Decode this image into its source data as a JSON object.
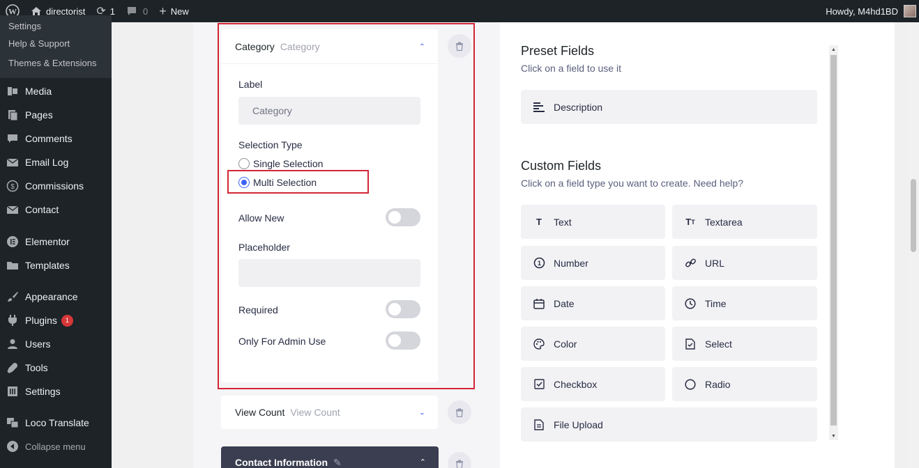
{
  "adminbar": {
    "site_name": "directorist",
    "updates_count": "1",
    "comments_count": "0",
    "new_label": "New",
    "howdy": "Howdy, M4hd1BD"
  },
  "sidebar": {
    "submenu": [
      "Settings",
      "Help & Support",
      "Themes & Extensions"
    ],
    "items": [
      {
        "label": "Media",
        "icon": "media-icon"
      },
      {
        "label": "Pages",
        "icon": "pages-icon"
      },
      {
        "label": "Comments",
        "icon": "comments-icon"
      },
      {
        "label": "Email Log",
        "icon": "email-icon"
      },
      {
        "label": "Commissions",
        "icon": "dollar-icon"
      },
      {
        "label": "Contact",
        "icon": "envelope-icon"
      },
      {
        "label": "Elementor",
        "icon": "elementor-icon"
      },
      {
        "label": "Templates",
        "icon": "folder-icon"
      },
      {
        "label": "Appearance",
        "icon": "brush-icon"
      },
      {
        "label": "Plugins",
        "icon": "plugin-icon",
        "badge": "1"
      },
      {
        "label": "Users",
        "icon": "user-icon"
      },
      {
        "label": "Tools",
        "icon": "wrench-icon"
      },
      {
        "label": "Settings",
        "icon": "settings-icon"
      },
      {
        "label": "Loco Translate",
        "icon": "translate-icon"
      },
      {
        "label": "Collapse menu",
        "icon": "collapse-icon"
      }
    ]
  },
  "category_field": {
    "title": "Category",
    "subtitle": "Category",
    "label_heading": "Label",
    "label_value": "Category",
    "selection_type_heading": "Selection Type",
    "option_single": "Single Selection",
    "option_multi": "Multi Selection",
    "selected_option": "Multi Selection",
    "allow_new": "Allow New",
    "allow_new_on": false,
    "placeholder_heading": "Placeholder",
    "placeholder_value": "",
    "required": "Required",
    "required_on": false,
    "admin_only": "Only For Admin Use",
    "admin_only_on": false
  },
  "view_count_field": {
    "title": "View Count",
    "subtitle": "View Count"
  },
  "contact_section": {
    "title": "Contact Information"
  },
  "preset": {
    "title": "Preset Fields",
    "subtitle": "Click on a field to use it",
    "fields": [
      {
        "label": "Description",
        "icon": "align-left-icon"
      }
    ]
  },
  "custom": {
    "title": "Custom Fields",
    "subtitle": "Click on a field type you want to create. Need help?",
    "fields": [
      {
        "label": "Text",
        "icon": "text-icon"
      },
      {
        "label": "Textarea",
        "icon": "textarea-icon"
      },
      {
        "label": "Number",
        "icon": "number-icon"
      },
      {
        "label": "URL",
        "icon": "link-icon"
      },
      {
        "label": "Date",
        "icon": "calendar-icon"
      },
      {
        "label": "Time",
        "icon": "clock-icon"
      },
      {
        "label": "Color",
        "icon": "palette-icon"
      },
      {
        "label": "Select",
        "icon": "select-icon"
      },
      {
        "label": "Checkbox",
        "icon": "checkbox-icon"
      },
      {
        "label": "Radio",
        "icon": "radio-icon"
      },
      {
        "label": "File Upload",
        "icon": "file-upload-icon"
      }
    ]
  },
  "colors": {
    "accent": "#3e62f5",
    "highlight": "#d32535",
    "admin_dark": "#1d2327"
  }
}
